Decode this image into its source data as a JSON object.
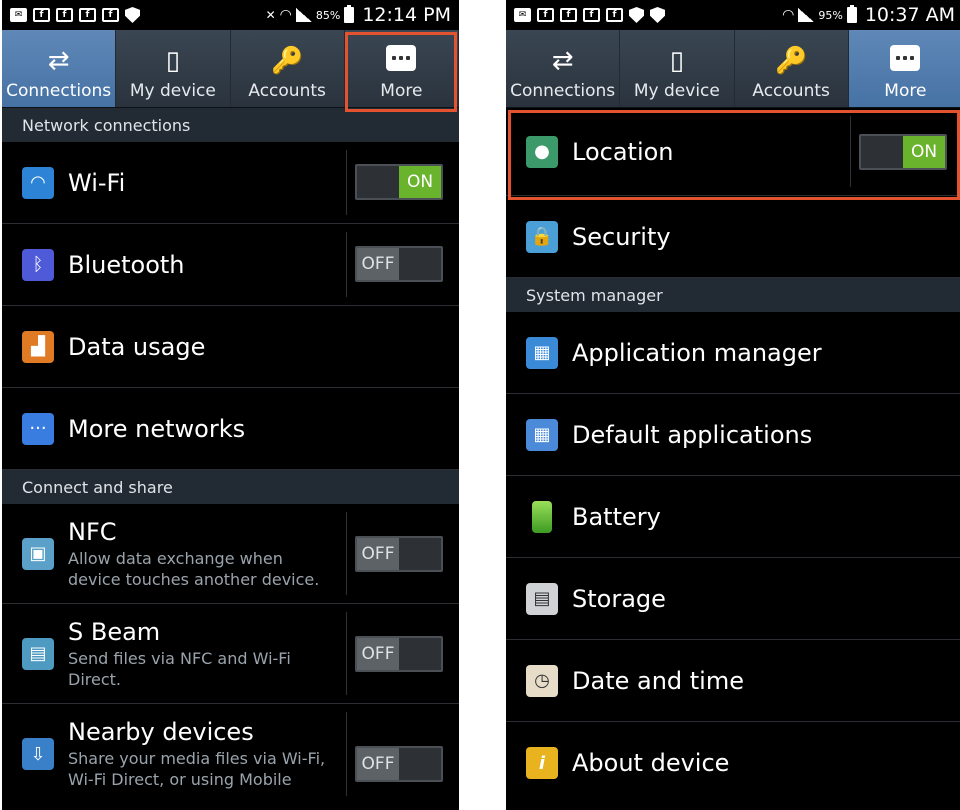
{
  "left": {
    "status": {
      "battery_pct": "85%",
      "time": "12:14 PM"
    },
    "tabs": [
      {
        "label": "Connections",
        "icon": "connections-icon"
      },
      {
        "label": "My device",
        "icon": "my-device-icon"
      },
      {
        "label": "Accounts",
        "icon": "accounts-icon"
      },
      {
        "label": "More",
        "icon": "more-icon"
      }
    ],
    "sections": {
      "network": "Network connections",
      "connect": "Connect and share"
    },
    "rows": {
      "wifi": {
        "label": "Wi-Fi",
        "toggle": "ON"
      },
      "bluetooth": {
        "label": "Bluetooth",
        "toggle": "OFF"
      },
      "data": {
        "label": "Data usage"
      },
      "morenet": {
        "label": "More networks"
      },
      "nfc": {
        "label": "NFC",
        "sub": "Allow data exchange when device touches another device.",
        "toggle": "OFF"
      },
      "sbeam": {
        "label": "S Beam",
        "sub": "Send files via NFC and Wi-Fi Direct.",
        "toggle": "OFF"
      },
      "nearby": {
        "label": "Nearby devices",
        "sub": "Share your media files via Wi-Fi, Wi-Fi Direct, or using Mobile",
        "toggle": "OFF"
      }
    }
  },
  "right": {
    "status": {
      "battery_pct": "95%",
      "time": "10:37 AM"
    },
    "tabs": [
      {
        "label": "Connections",
        "icon": "connections-icon"
      },
      {
        "label": "My device",
        "icon": "my-device-icon"
      },
      {
        "label": "Accounts",
        "icon": "accounts-icon"
      },
      {
        "label": "More",
        "icon": "more-icon"
      }
    ],
    "sections": {
      "system": "System manager"
    },
    "rows": {
      "location": {
        "label": "Location",
        "toggle": "ON"
      },
      "security": {
        "label": "Security"
      },
      "appmgr": {
        "label": "Application manager"
      },
      "defapps": {
        "label": "Default applications"
      },
      "battery": {
        "label": "Battery"
      },
      "storage": {
        "label": "Storage"
      },
      "datetime": {
        "label": "Date and time"
      },
      "about": {
        "label": "About device"
      }
    }
  },
  "colors": {
    "highlight": "#e4532f",
    "toggle_on": "#6ab42d",
    "active_tab": "#4f7bac"
  }
}
